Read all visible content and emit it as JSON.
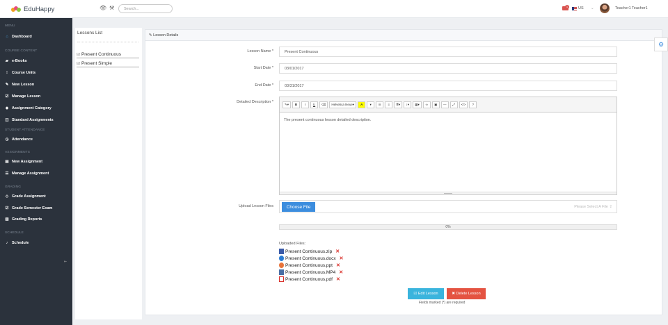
{
  "app": {
    "name": "EduHappy"
  },
  "topbar": {
    "search_placeholder": "Search...",
    "notification_count": "1",
    "language": "US",
    "user_name": "Teacher1 Teacher1"
  },
  "sidebar": {
    "sections": [
      {
        "heading": "MENU",
        "items": [
          {
            "label": "Dashboard",
            "icon": "home-icon"
          }
        ]
      },
      {
        "heading": "COURSE CONTENT",
        "items": [
          {
            "label": "e-Books",
            "icon": "book-icon"
          },
          {
            "label": "Course Units",
            "icon": "grid-icon"
          },
          {
            "label": "New Lesson",
            "icon": "pencil-icon"
          },
          {
            "label": "Manage Lesson",
            "icon": "edit-icon"
          },
          {
            "label": "Assignment Category",
            "icon": "tag-icon"
          },
          {
            "label": "Standard Assignments",
            "icon": "columns-icon"
          }
        ]
      },
      {
        "heading": "STUDENT ATTENDANCE",
        "items": [
          {
            "label": "Attendance",
            "icon": "clock-icon"
          }
        ]
      },
      {
        "heading": "ASSIGNMENTS",
        "items": [
          {
            "label": "New Assignment",
            "icon": "form-icon"
          },
          {
            "label": "Manage Assignment",
            "icon": "list-icon"
          }
        ]
      },
      {
        "heading": "GRADING",
        "items": [
          {
            "label": "Grade Assignment",
            "icon": "diamond-icon"
          },
          {
            "label": "Grade Semester Exam",
            "icon": "check-square-icon"
          },
          {
            "label": "Grading Reports",
            "icon": "bar-chart-icon"
          }
        ]
      },
      {
        "heading": "SCHEDULE",
        "items": [
          {
            "label": "Schedule",
            "icon": "bell-icon"
          }
        ]
      }
    ]
  },
  "lessons_list": {
    "title": "Lessons List",
    "items": [
      "Present Continuous",
      "Present Simple"
    ]
  },
  "lesson_details": {
    "header": "Lesson Details",
    "fields": {
      "lesson_name": {
        "label": "Lesson Name *",
        "value": "Present Continuous"
      },
      "start_date": {
        "label": "Start Date *",
        "value": "03/01/2017"
      },
      "end_date": {
        "label": "End Date *",
        "value": "03/31/2017"
      },
      "description": {
        "label": "Detailed Description *",
        "value": "The present continuous lesson detailed description."
      }
    },
    "editor_toolbar": {
      "font_name": "Helvetica Neue",
      "bold": "B",
      "italic": "I",
      "underline": "U",
      "help": "?"
    },
    "upload": {
      "label": "Upload Lesson Files",
      "button": "Choose File",
      "hint": "Please Select A File"
    },
    "progress": {
      "percent": 0,
      "text": "0%"
    },
    "uploaded_files": {
      "title": "Uploaded Files:",
      "files": [
        {
          "name": "Present Continuous.zip",
          "color": "#3a5aa8"
        },
        {
          "name": "Present Continuous.docx",
          "color": "#2b7cd3"
        },
        {
          "name": "Present Continuous.ppt",
          "color": "#e8743b"
        },
        {
          "name": "Present Continuous.MP4",
          "color": "#4a6fa5"
        },
        {
          "name": "Present Continuous.pdf",
          "color": "#d9302a"
        }
      ]
    },
    "buttons": {
      "edit": "Edit Lesson",
      "delete": "Delete Lesson"
    },
    "required_note": "Fields marked (*) are required"
  }
}
